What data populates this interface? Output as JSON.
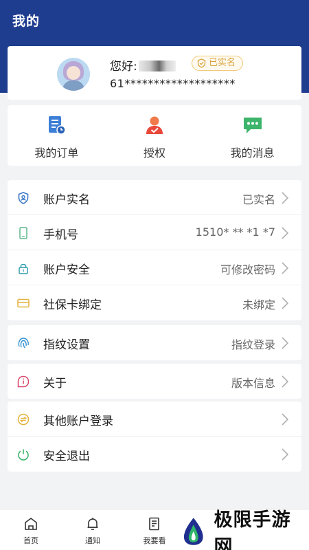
{
  "header": {
    "title": "我的"
  },
  "profile": {
    "greeting": "您好:",
    "verified_label": "已实名",
    "phone_masked": "61*******************"
  },
  "shortcuts": [
    {
      "label": "我的订单",
      "icon": "order-icon"
    },
    {
      "label": "授权",
      "icon": "authorize-person-icon"
    },
    {
      "label": "我的消息",
      "icon": "message-icon"
    }
  ],
  "menu": [
    {
      "label": "账户实名",
      "value": "已实名",
      "icon": "shield-id-icon"
    },
    {
      "label": "手机号",
      "value": "1510* ** *1 *7",
      "icon": "phone-icon"
    },
    {
      "label": "账户安全",
      "value": "可修改密码",
      "icon": "lock-icon"
    },
    {
      "label": "社保卡绑定",
      "value": "未绑定",
      "icon": "card-icon"
    },
    {
      "label": "指纹设置",
      "value": "指纹登录",
      "icon": "fingerprint-icon"
    },
    {
      "label": "关于",
      "value": "版本信息",
      "icon": "info-icon"
    },
    {
      "label": "其他账户登录",
      "value": "",
      "icon": "switch-account-icon"
    },
    {
      "label": "安全退出",
      "value": "",
      "icon": "power-icon"
    }
  ],
  "tabs": [
    {
      "label": "首页",
      "icon": "home-icon"
    },
    {
      "label": "通知",
      "icon": "bell-icon"
    },
    {
      "label": "我要看",
      "icon": "document-icon"
    }
  ],
  "watermark": {
    "text": "极限手游网"
  },
  "colors": {
    "header": "#1e3d8f",
    "badge": "#d9a23a",
    "background": "#f2f3f5"
  }
}
